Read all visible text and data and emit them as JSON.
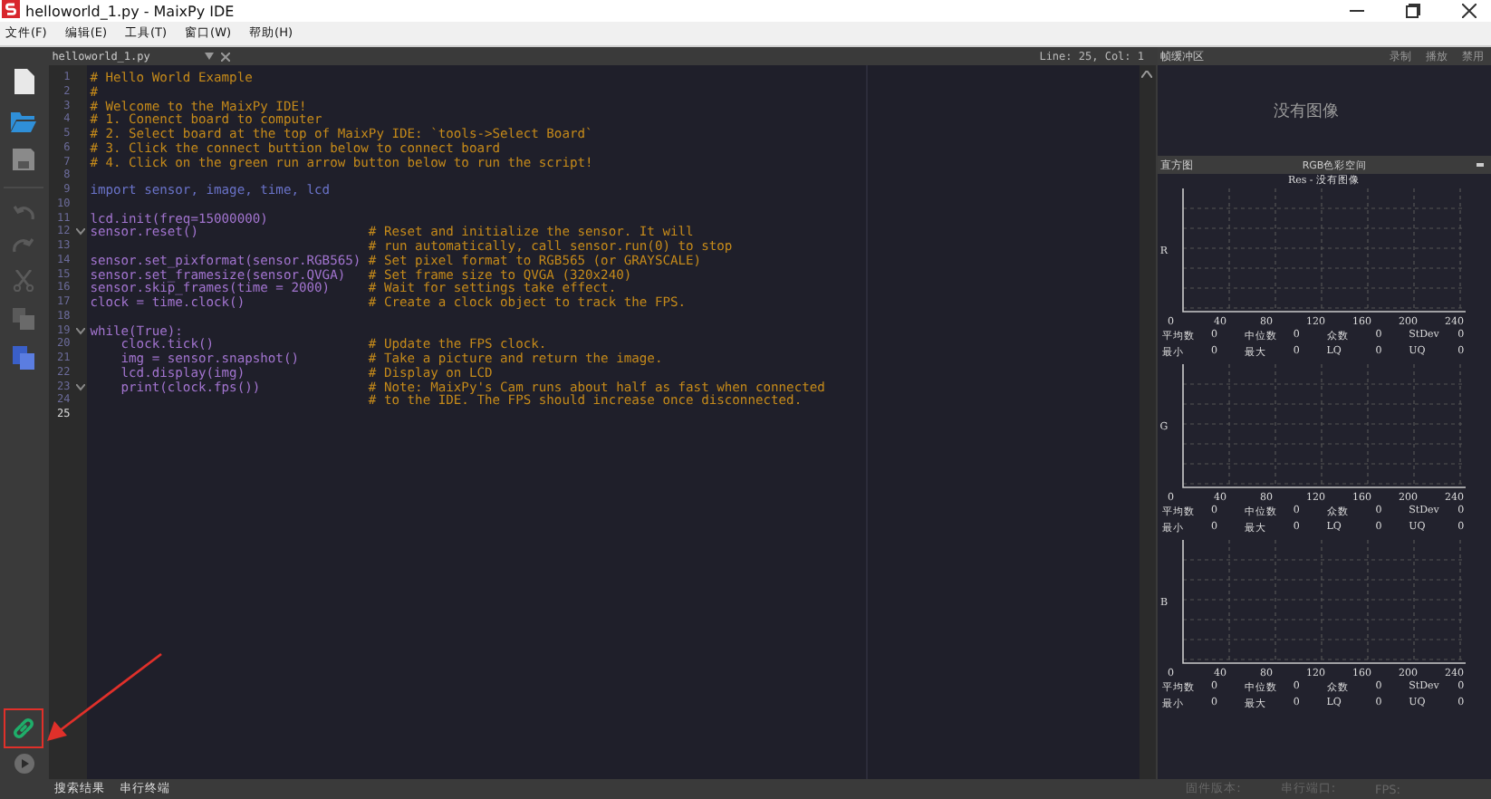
{
  "window": {
    "title": "helloworld_1.py - MaixPy IDE"
  },
  "menu": [
    "文件(F)",
    "编辑(E)",
    "工具(T)",
    "窗口(W)",
    "帮助(H)"
  ],
  "editor": {
    "tab": "helloworld_1.py",
    "position": "Line: 25, Col: 1",
    "lines": [
      {
        "n": "1",
        "kind": "comment",
        "comment": "# Hello World Example",
        "indented": false,
        "fold": false
      },
      {
        "n": "2",
        "kind": "comment",
        "comment": "#",
        "indented": false,
        "fold": false
      },
      {
        "n": "3",
        "kind": "comment",
        "comment": "# Welcome to the MaixPy IDE!",
        "indented": false,
        "fold": false
      },
      {
        "n": "4",
        "kind": "comment",
        "comment": "# 1. Conenct board to computer",
        "indented": false,
        "fold": false
      },
      {
        "n": "5",
        "kind": "comment",
        "comment": "# 2. Select board at the top of MaixPy IDE: `tools->Select Board`",
        "indented": false,
        "fold": false
      },
      {
        "n": "6",
        "kind": "comment",
        "comment": "# 3. Click the connect buttion below to connect board",
        "indented": false,
        "fold": false
      },
      {
        "n": "7",
        "kind": "comment",
        "comment": "# 4. Click on the green run arrow button below to run the script!",
        "indented": false,
        "fold": false
      },
      {
        "n": "8",
        "kind": "blank",
        "fold": false
      },
      {
        "n": "9",
        "kind": "import",
        "code": "import sensor, image, time, lcd",
        "indented": false,
        "fold": false
      },
      {
        "n": "10",
        "kind": "blank",
        "fold": false
      },
      {
        "n": "11",
        "kind": "code",
        "code": "lcd.init(freq=15000000)",
        "indented": false,
        "fold": false
      },
      {
        "n": "12",
        "kind": "trailing",
        "code": "sensor.reset()",
        "comment": "# Reset and initialize the sensor. It will",
        "indented": false,
        "fold": true
      },
      {
        "n": "13",
        "kind": "trailing",
        "comment": "# run automatically, call sensor.run(0) to stop",
        "fold": false
      },
      {
        "n": "14",
        "kind": "trailing",
        "code": "sensor.set_pixformat(sensor.RGB565)",
        "comment": "# Set pixel format to RGB565 (or GRAYSCALE)",
        "indented": false,
        "fold": false
      },
      {
        "n": "15",
        "kind": "trailing",
        "code": "sensor.set_framesize(sensor.QVGA)",
        "comment": "# Set frame size to QVGA (320x240)",
        "indented": false,
        "fold": false
      },
      {
        "n": "16",
        "kind": "trailing",
        "code": "sensor.skip_frames(time = 2000)",
        "comment": "# Wait for settings take effect.",
        "indented": false,
        "fold": false
      },
      {
        "n": "17",
        "kind": "trailing",
        "code": "clock = time.clock()",
        "comment": "# Create a clock object to track the FPS.",
        "indented": false,
        "fold": false
      },
      {
        "n": "18",
        "kind": "blank",
        "fold": false
      },
      {
        "n": "19",
        "kind": "code",
        "code": "while(True):",
        "indented": false,
        "fold": true
      },
      {
        "n": "20",
        "kind": "trailing",
        "code": "clock.tick()",
        "comment": "# Update the FPS clock.",
        "indented": true,
        "fold": false
      },
      {
        "n": "21",
        "kind": "trailing",
        "code": "img = sensor.snapshot()",
        "comment": "# Take a picture and return the image.",
        "indented": true,
        "fold": false
      },
      {
        "n": "22",
        "kind": "trailing",
        "code": "lcd.display(img)",
        "comment": "# Display on LCD",
        "indented": true,
        "fold": false
      },
      {
        "n": "23",
        "kind": "trailing",
        "code": "print(clock.fps())",
        "comment": "# Note: MaixPy's Cam runs about half as fast when connected",
        "indented": true,
        "fold": true
      },
      {
        "n": "24",
        "kind": "trailing",
        "comment": "# to the IDE. The FPS should increase once disconnected.",
        "fold": false
      },
      {
        "n": "25",
        "kind": "blank",
        "fold": false
      }
    ]
  },
  "frame_buffer": {
    "title": "帧缓冲区",
    "actions": [
      "录制",
      "播放",
      "禁用"
    ],
    "message": "没有图像"
  },
  "histogram": {
    "title": "直方图",
    "color_space": "RGB色彩空间",
    "caption": "Res - 没有图像",
    "channels": [
      {
        "label": "R",
        "x_ticks": [
          "0",
          "40",
          "80",
          "120",
          "160",
          "200",
          "240"
        ],
        "stats": [
          [
            "平均数",
            "0"
          ],
          [
            "中位数",
            "0"
          ],
          [
            "众数",
            "0"
          ],
          [
            "StDev",
            "0"
          ],
          [
            "最小",
            "0"
          ],
          [
            "最大",
            "0"
          ],
          [
            "LQ",
            "0"
          ],
          [
            "UQ",
            "0"
          ]
        ]
      },
      {
        "label": "G",
        "x_ticks": [
          "0",
          "40",
          "80",
          "120",
          "160",
          "200",
          "240"
        ],
        "stats": [
          [
            "平均数",
            "0"
          ],
          [
            "中位数",
            "0"
          ],
          [
            "众数",
            "0"
          ],
          [
            "StDev",
            "0"
          ],
          [
            "最小",
            "0"
          ],
          [
            "最大",
            "0"
          ],
          [
            "LQ",
            "0"
          ],
          [
            "UQ",
            "0"
          ]
        ]
      },
      {
        "label": "B",
        "x_ticks": [
          "0",
          "40",
          "80",
          "120",
          "160",
          "200",
          "240"
        ],
        "stats": [
          [
            "平均数",
            "0"
          ],
          [
            "中位数",
            "0"
          ],
          [
            "众数",
            "0"
          ],
          [
            "StDev",
            "0"
          ],
          [
            "最小",
            "0"
          ],
          [
            "最大",
            "0"
          ],
          [
            "LQ",
            "0"
          ],
          [
            "UQ",
            "0"
          ]
        ]
      }
    ]
  },
  "status_bar": {
    "tabs": [
      "搜索结果",
      "串行终端"
    ],
    "info": [
      "固件版本:",
      "串行端口:",
      "FPS:"
    ]
  }
}
